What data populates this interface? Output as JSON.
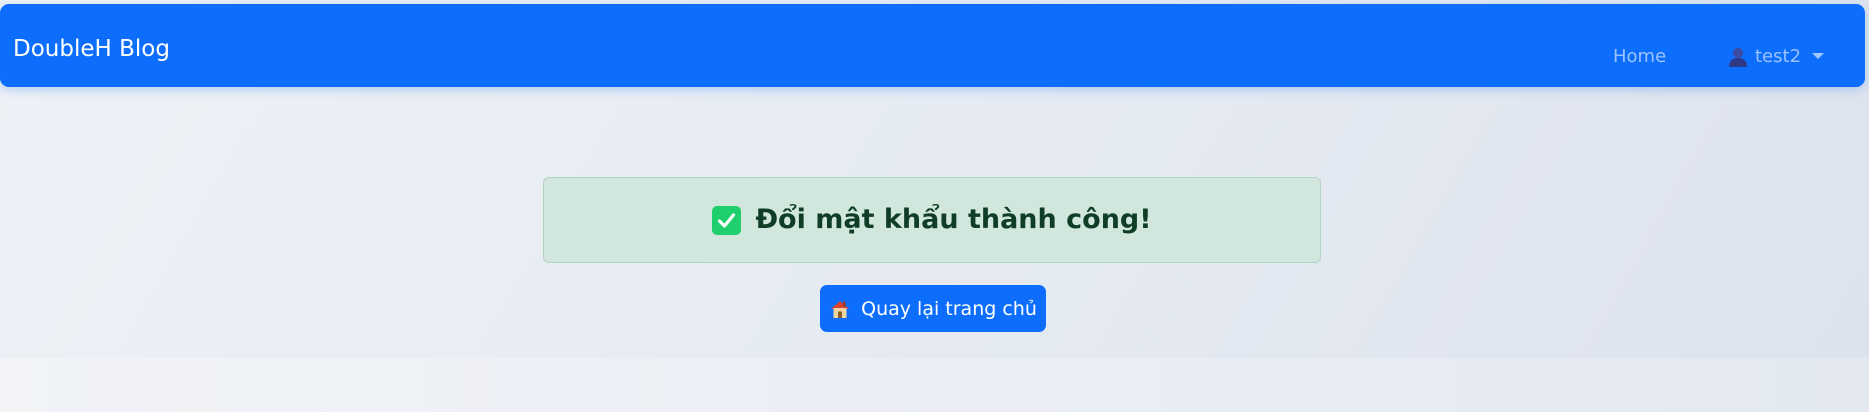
{
  "navbar": {
    "brand": "DoubleH Blog",
    "links": [
      {
        "label": "Home"
      }
    ],
    "user": {
      "name": "test2",
      "icon": "user-icon"
    },
    "color": "#0d6efd"
  },
  "main": {
    "alert": {
      "icon": "check-icon",
      "message": "Đổi mật khẩu thành công!",
      "color": "#d1e7dd"
    },
    "home_button": {
      "icon": "house-icon",
      "label": "Quay lại trang chủ"
    }
  }
}
